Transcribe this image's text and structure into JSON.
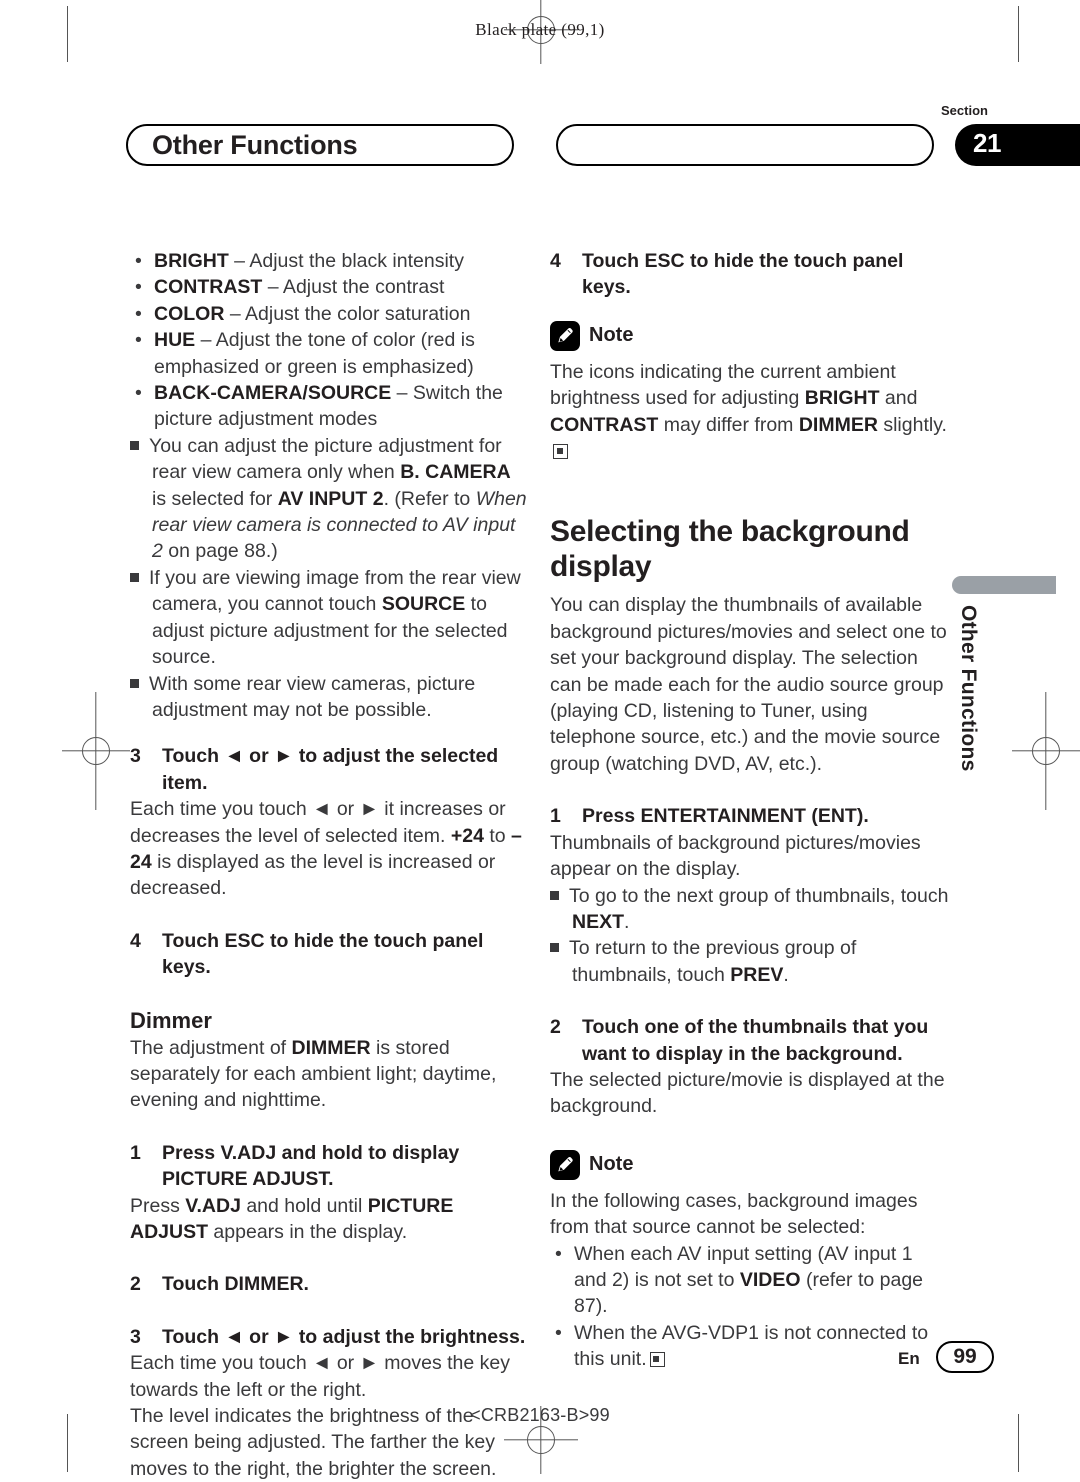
{
  "page": {
    "black_plate": "Black plate (99,1)",
    "section_label": "Section",
    "section_number": "21",
    "header_title": "Other Functions",
    "side_tab_text": "Other Functions",
    "footer_lang": "En",
    "footer_page": "99",
    "footer_code": "<CRB2163-B>99"
  },
  "left_column": {
    "adjust_items": [
      {
        "term": "BRIGHT",
        "desc": " – Adjust the black intensity"
      },
      {
        "term": "CONTRAST",
        "desc": " – Adjust the contrast"
      },
      {
        "term": "COLOR",
        "desc": " – Adjust the color saturation"
      },
      {
        "term": "HUE",
        "desc": " – Adjust the tone of color (red is emphasized or green is emphasized)"
      },
      {
        "term": "BACK-CAMERA/SOURCE",
        "desc": " – Switch the picture adjustment modes"
      }
    ],
    "note1_a": "You can adjust the picture adjustment for rear view camera only when ",
    "note1_b": "B. CAMERA",
    "note1_c": " is selected for ",
    "note1_d": "AV INPUT 2",
    "note1_e": ". (Refer to ",
    "note1_f": "When rear view camera is connected to AV input 2",
    "note1_g": " on page 88.)",
    "note2_a": "If you are viewing image from the rear view camera, you cannot touch ",
    "note2_b": "SOURCE",
    "note2_c": " to adjust picture adjustment for the selected source.",
    "note3": "With some rear view cameras, picture adjustment may not be possible.",
    "step3_num": "3",
    "step3_text": "Touch ◄ or ► to adjust the selected item.",
    "step3_body_a": "Each time you touch ◄ or ► it increases or decreases the level of selected item. ",
    "step3_body_b": "+24",
    "step3_body_c": " to ",
    "step3_body_d": "–24",
    "step3_body_e": " is displayed as the level is increased or decreased.",
    "step4_num": "4",
    "step4_text": "Touch ESC to hide the touch panel keys.",
    "dimmer_heading": "Dimmer",
    "dimmer_body_a": "The adjustment of ",
    "dimmer_body_b": "DIMMER",
    "dimmer_body_c": " is stored separately for each ambient light; daytime, evening and nighttime.",
    "d_step1_num": "1",
    "d_step1_text": "Press V.ADJ and hold to display PICTURE ADJUST.",
    "d_step1_body_a": "Press ",
    "d_step1_body_b": "V.ADJ",
    "d_step1_body_c": " and hold until ",
    "d_step1_body_d": "PICTURE ADJUST",
    "d_step1_body_e": " appears in the display.",
    "d_step2_num": "2",
    "d_step2_text": "Touch DIMMER.",
    "d_step3_num": "3",
    "d_step3_text": "Touch ◄ or ► to adjust the brightness.",
    "d_step3_body1": "Each time you touch ◄ or ► moves the key towards the left or the right.",
    "d_step3_body2": "The level indicates the brightness of the screen being adjusted. The farther the key moves to the right, the brighter the screen."
  },
  "right_column": {
    "step4_num": "4",
    "step4_text": "Touch ESC to hide the touch panel keys.",
    "note_word": "Note",
    "note1_a": "The icons indicating the current ambient brightness used for adjusting ",
    "note1_b": "BRIGHT",
    "note1_c": " and ",
    "note1_d": "CONTRAST",
    "note1_e": " may differ from ",
    "note1_f": "DIMMER",
    "note1_g": " slightly.",
    "heading": "Selecting the background display",
    "intro": "You can display the thumbnails of available background pictures/movies and select one to set your background display. The selection can be made each for the audio source group (playing CD, listening to Tuner, using telephone source, etc.) and the movie source group (watching DVD, AV, etc.).",
    "step1_num": "1",
    "step1_text": "Press ENTERTAINMENT (ENT).",
    "step1_body": "Thumbnails of background pictures/movies appear on the display.",
    "sub1_a": "To go to the next group of thumbnails, touch ",
    "sub1_b": "NEXT",
    "sub1_c": ".",
    "sub2_a": "To return to the previous group of thumbnails, touch ",
    "sub2_b": "PREV",
    "sub2_c": ".",
    "step2_num": "2",
    "step2_text": "Touch one of the thumbnails that you want to display in the background.",
    "step2_body": "The selected picture/movie is displayed at the background.",
    "note2_intro": "In the following cases, background images from that source cannot be selected:",
    "case1_a": "When each AV input setting (AV input 1 and 2) is not set to ",
    "case1_b": "VIDEO",
    "case1_c": " (refer to page 87).",
    "case2_a": "When the AVG-VDP1 is not connected to this unit."
  }
}
